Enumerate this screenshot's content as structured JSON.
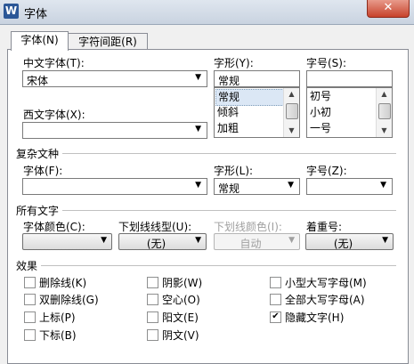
{
  "window": {
    "title": "字体",
    "logo_letter": "W",
    "close_symbol": "✕"
  },
  "tabs": [
    {
      "label": "字体(N)",
      "active": true
    },
    {
      "label": "字符间距(R)",
      "active": false
    }
  ],
  "font": {
    "chinese_label": "中文字体(T):",
    "chinese_value": "宋体",
    "western_label": "西文字体(X):",
    "western_value": "",
    "style_label": "字形(Y):",
    "style_value": "常规",
    "style_options": [
      "常规",
      "倾斜",
      "加粗"
    ],
    "size_label": "字号(S):",
    "size_value": "",
    "size_options": [
      "初号",
      "小初",
      "一号"
    ]
  },
  "complex": {
    "section": "复杂文种",
    "font_label": "字体(F):",
    "font_value": "",
    "style_label": "字形(L):",
    "style_value": "常规",
    "size_label": "字号(Z):",
    "size_value": ""
  },
  "all_text": {
    "section": "所有文字",
    "color_label": "字体颜色(C):",
    "color_value": "",
    "underline_label": "下划线线型(U):",
    "underline_value": "(无)",
    "underline_color_label": "下划线颜色(I):",
    "underline_color_value": "自动",
    "emphasis_label": "着重号:",
    "emphasis_value": "(无)"
  },
  "effects": {
    "section": "效果",
    "items": [
      {
        "label": "删除线(K)",
        "checked": false
      },
      {
        "label": "双删除线(G)",
        "checked": false
      },
      {
        "label": "上标(P)",
        "checked": false
      },
      {
        "label": "下标(B)",
        "checked": false
      },
      {
        "label": "阴影(W)",
        "checked": false
      },
      {
        "label": "空心(O)",
        "checked": false
      },
      {
        "label": "阳文(E)",
        "checked": false
      },
      {
        "label": "阴文(V)",
        "checked": false
      },
      {
        "label": "小型大写字母(M)",
        "checked": false
      },
      {
        "label": "全部大写字母(A)",
        "checked": false
      },
      {
        "label": "隐藏文字(H)",
        "checked": true
      }
    ]
  },
  "icons": {
    "dropdown": "▼",
    "scroll_up": "▲",
    "scroll_down": "▼",
    "check": "✔"
  }
}
